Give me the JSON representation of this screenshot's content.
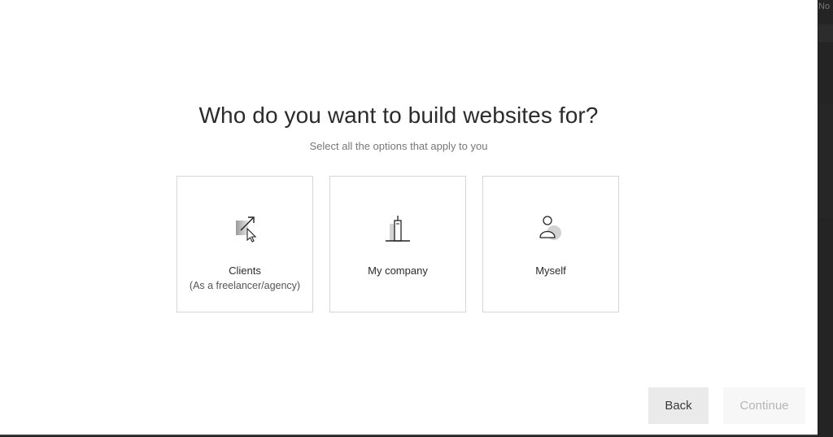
{
  "backdrop": {
    "peek_text": "No"
  },
  "dialog": {
    "title": "Who do you want to build websites for?",
    "subtitle": "Select all the options that apply to you"
  },
  "options": [
    {
      "label": "Clients",
      "sublabel": "(As a freelancer/agency)",
      "icon": "clients-icon"
    },
    {
      "label": "My company",
      "sublabel": "",
      "icon": "building-icon"
    },
    {
      "label": "Myself",
      "sublabel": "",
      "icon": "person-icon"
    }
  ],
  "footer": {
    "back_label": "Back",
    "continue_label": "Continue"
  },
  "colors": {
    "title": "#2b2b2b",
    "card_border": "#d6d6d6",
    "back_bg": "#eaeaea",
    "continue_bg": "#f7f7f7",
    "continue_text_disabled": "#b5b5b5"
  }
}
